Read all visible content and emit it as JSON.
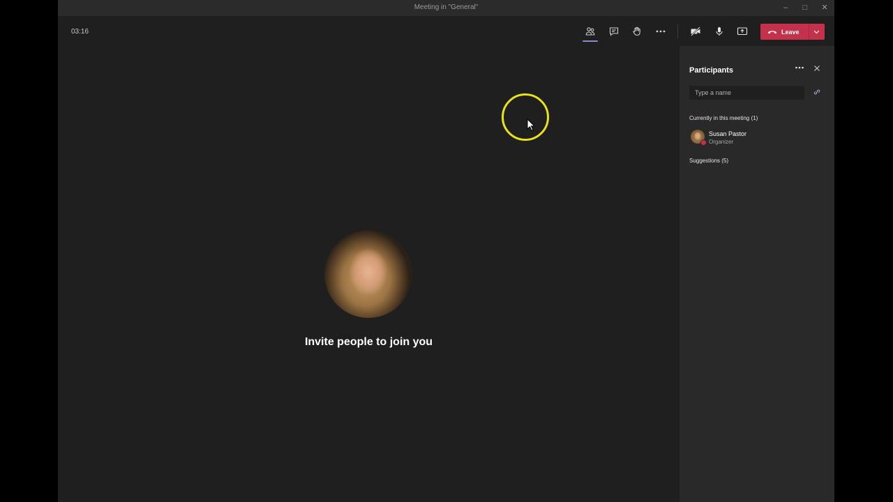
{
  "window": {
    "title": "Meeting in \"General\"",
    "controls": {
      "minimize": "–",
      "maximize": "□",
      "close": "✕"
    }
  },
  "toolbar": {
    "timer": "03:16",
    "buttons": [
      {
        "name": "participants-icon",
        "active": true
      },
      {
        "name": "chat-icon"
      },
      {
        "name": "raise-hand-icon"
      },
      {
        "name": "more-icon"
      },
      {
        "name": "camera-off-icon"
      },
      {
        "name": "microphone-icon"
      },
      {
        "name": "share-screen-icon"
      }
    ],
    "leave_label": "Leave",
    "leave_color": "#c4314b"
  },
  "stage": {
    "invite_text": "Invite people to join you"
  },
  "participants_panel": {
    "title": "Participants",
    "search_placeholder": "Type a name",
    "current_section": "Currently in this meeting (1)",
    "participants": [
      {
        "name": "Susan Pastor",
        "role": "Organizer"
      }
    ],
    "suggestions_section": "Suggestions (5)"
  },
  "colors": {
    "accent": "#8b8cc7",
    "cursor_highlight": "#e9e21a",
    "background": "#1f1f1f",
    "panel": "#292929"
  }
}
